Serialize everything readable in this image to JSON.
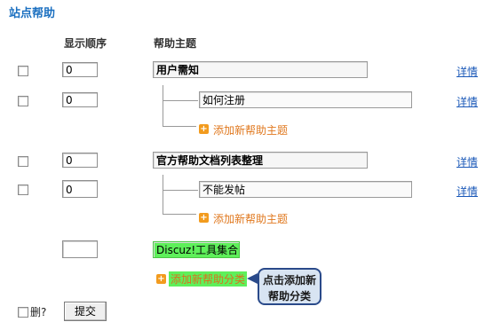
{
  "page_title": "站点帮助",
  "headers": {
    "order": "显示顺序",
    "topic": "帮助主题"
  },
  "rows": [
    {
      "order": "0",
      "topic": "用户需知",
      "detail": "详情"
    },
    {
      "order": "0",
      "topic": "如何注册",
      "detail": "详情"
    },
    {
      "add_label": "添加新帮助主题"
    },
    {
      "order": "0",
      "topic": "官方帮助文档列表整理",
      "detail": "详情"
    },
    {
      "order": "0",
      "topic": "不能发帖",
      "detail": "详情"
    },
    {
      "add_label": "添加新帮助主题"
    },
    {
      "order": "",
      "topic": "Discuz!工具集合"
    },
    {
      "add_label": "添加新帮助分类"
    }
  ],
  "callout": {
    "line1": "点击添加新",
    "line2": "帮助分类"
  },
  "footer": {
    "delete_label": "删?",
    "submit_label": "提交"
  },
  "icons": {
    "add": "plus-icon"
  },
  "colors": {
    "accent": "#1a6fc0",
    "highlight": "#5ef05a",
    "add_text": "#e0781e"
  }
}
